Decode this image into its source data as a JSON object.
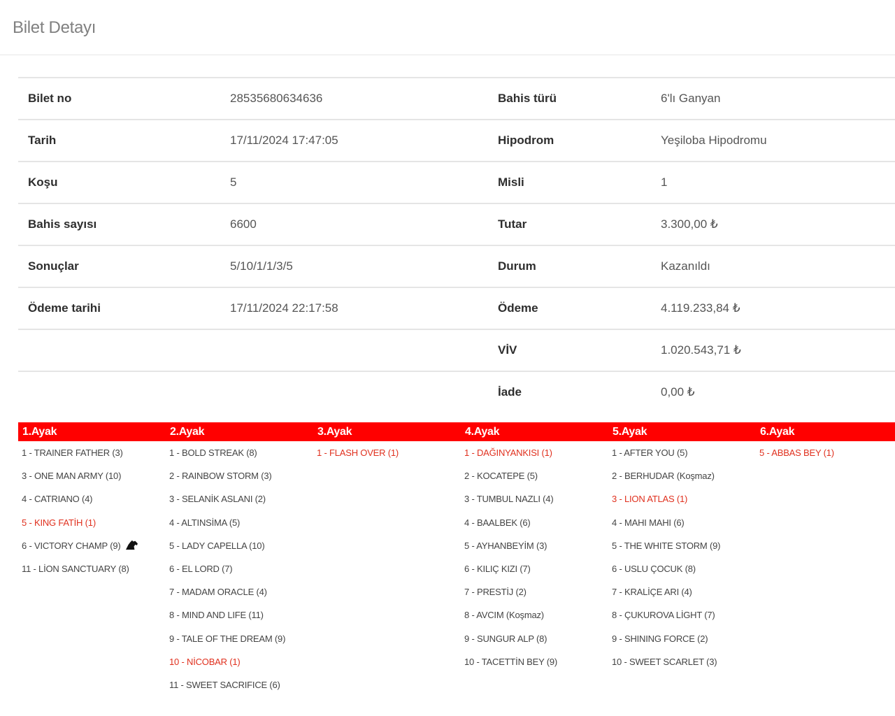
{
  "page": {
    "title": "Bilet Detayı"
  },
  "details": [
    {
      "left_label": "Bilet no",
      "left_value": "28535680634636",
      "right_label": "Bahis türü",
      "right_value": "6'lı Ganyan"
    },
    {
      "left_label": "Tarih",
      "left_value": "17/11/2024 17:47:05",
      "right_label": "Hipodrom",
      "right_value": "Yeşiloba Hipodromu"
    },
    {
      "left_label": "Koşu",
      "left_value": "5",
      "right_label": "Misli",
      "right_value": "1"
    },
    {
      "left_label": "Bahis sayısı",
      "left_value": "6600",
      "right_label": "Tutar",
      "right_value": "3.300,00 ₺"
    },
    {
      "left_label": "Sonuçlar",
      "left_value": "5/10/1/1/3/5",
      "right_label": "Durum",
      "right_value": "Kazanıldı"
    },
    {
      "left_label": "Ödeme tarihi",
      "left_value": "17/11/2024 22:17:58",
      "right_label": "Ödeme",
      "right_value": "4.119.233,84 ₺"
    },
    {
      "left_label": "",
      "left_value": "",
      "right_label": "VİV",
      "right_value": "1.020.543,71 ₺"
    },
    {
      "left_label": "",
      "left_value": "",
      "right_label": "İade",
      "right_value": "0,00 ₺"
    }
  ],
  "legs": [
    {
      "header": "1.Ayak",
      "horses": [
        {
          "text": "1 - TRAINER FATHER (3)",
          "winner": false
        },
        {
          "text": "3 - ONE MAN ARMY (10)",
          "winner": false
        },
        {
          "text": "4 - CATRIANO (4)",
          "winner": false
        },
        {
          "text": "5 - KING FATİH (1)",
          "winner": true
        },
        {
          "text": "6 - VICTORY CHAMP (9)",
          "winner": false,
          "icon": "horse-head-icon"
        },
        {
          "text": "11 - LİON SANCTUARY (8)",
          "winner": false
        }
      ]
    },
    {
      "header": "2.Ayak",
      "horses": [
        {
          "text": "1 - BOLD STREAK (8)",
          "winner": false
        },
        {
          "text": "2 - RAINBOW STORM (3)",
          "winner": false
        },
        {
          "text": "3 - SELANİK ASLANI (2)",
          "winner": false
        },
        {
          "text": "4 - ALTINSİMA (5)",
          "winner": false
        },
        {
          "text": "5 - LADY CAPELLA (10)",
          "winner": false
        },
        {
          "text": "6 - EL LORD (7)",
          "winner": false
        },
        {
          "text": "7 - MADAM ORACLE (4)",
          "winner": false
        },
        {
          "text": "8 - MIND AND LIFE (11)",
          "winner": false
        },
        {
          "text": "9 - TALE OF THE DREAM (9)",
          "winner": false
        },
        {
          "text": "10 - NİCOBAR (1)",
          "winner": true
        },
        {
          "text": "11 - SWEET SACRIFICE (6)",
          "winner": false
        }
      ]
    },
    {
      "header": "3.Ayak",
      "horses": [
        {
          "text": "1 - FLASH OVER (1)",
          "winner": true
        }
      ]
    },
    {
      "header": "4.Ayak",
      "horses": [
        {
          "text": "1 - DAĞINYANKISI (1)",
          "winner": true
        },
        {
          "text": "2 - KOCATEPE (5)",
          "winner": false
        },
        {
          "text": "3 - TUMBUL NAZLI (4)",
          "winner": false
        },
        {
          "text": "4 - BAALBEK (6)",
          "winner": false
        },
        {
          "text": "5 - AYHANBEYİM (3)",
          "winner": false
        },
        {
          "text": "6 - KILIÇ KIZI (7)",
          "winner": false
        },
        {
          "text": "7 - PRESTİJ (2)",
          "winner": false
        },
        {
          "text": "8 - AVCIM (Koşmaz)",
          "winner": false
        },
        {
          "text": "9 - SUNGUR ALP (8)",
          "winner": false
        },
        {
          "text": "10 - TACETTİN BEY (9)",
          "winner": false
        }
      ]
    },
    {
      "header": "5.Ayak",
      "horses": [
        {
          "text": "1 - AFTER YOU (5)",
          "winner": false
        },
        {
          "text": "2 - BERHUDAR (Koşmaz)",
          "winner": false
        },
        {
          "text": "3 - LION ATLAS (1)",
          "winner": true
        },
        {
          "text": "4 - MAHI MAHI (6)",
          "winner": false
        },
        {
          "text": "5 - THE WHITE STORM (9)",
          "winner": false
        },
        {
          "text": "6 - USLU ÇOCUK (8)",
          "winner": false
        },
        {
          "text": "7 - KRALİÇE ARI (4)",
          "winner": false
        },
        {
          "text": "8 - ÇUKUROVA LİGHT (7)",
          "winner": false
        },
        {
          "text": "9 - SHINING FORCE (2)",
          "winner": false
        },
        {
          "text": "10 - SWEET SCARLET (3)",
          "winner": false
        }
      ]
    },
    {
      "header": "6.Ayak",
      "horses": [
        {
          "text": "5 - ABBAS BEY (1)",
          "winner": true
        }
      ]
    }
  ],
  "colors": {
    "leg_header_bg": "#ff0000",
    "winner_text": "#e0301e"
  }
}
